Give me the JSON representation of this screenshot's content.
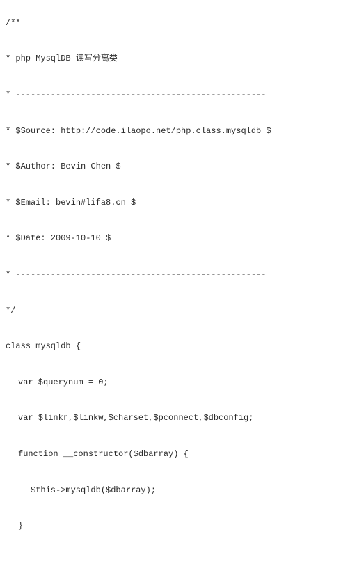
{
  "code": {
    "l1": "/**",
    "l2": "* php MysqlDB 读写分离类",
    "l3": "* --------------------------------------------------",
    "l4": "* $Source: http://code.ilaopo.net/php.class.mysqldb $",
    "l5": "* $Author: Bevin Chen $",
    "l6": "* $Email: bevin#lifa8.cn $",
    "l7": "* $Date: 2009-10-10 $",
    "l8": "* --------------------------------------------------",
    "l9": "*/",
    "l10": "class mysqldb {",
    "l11": "var $querynum = 0;",
    "l12": "var $linkr,$linkw,$charset,$pconnect,$dbconfig;",
    "l13": "function __constructor($dbarray) {",
    "l14": "$this->mysqldb($dbarray);",
    "l15": "}"
  }
}
